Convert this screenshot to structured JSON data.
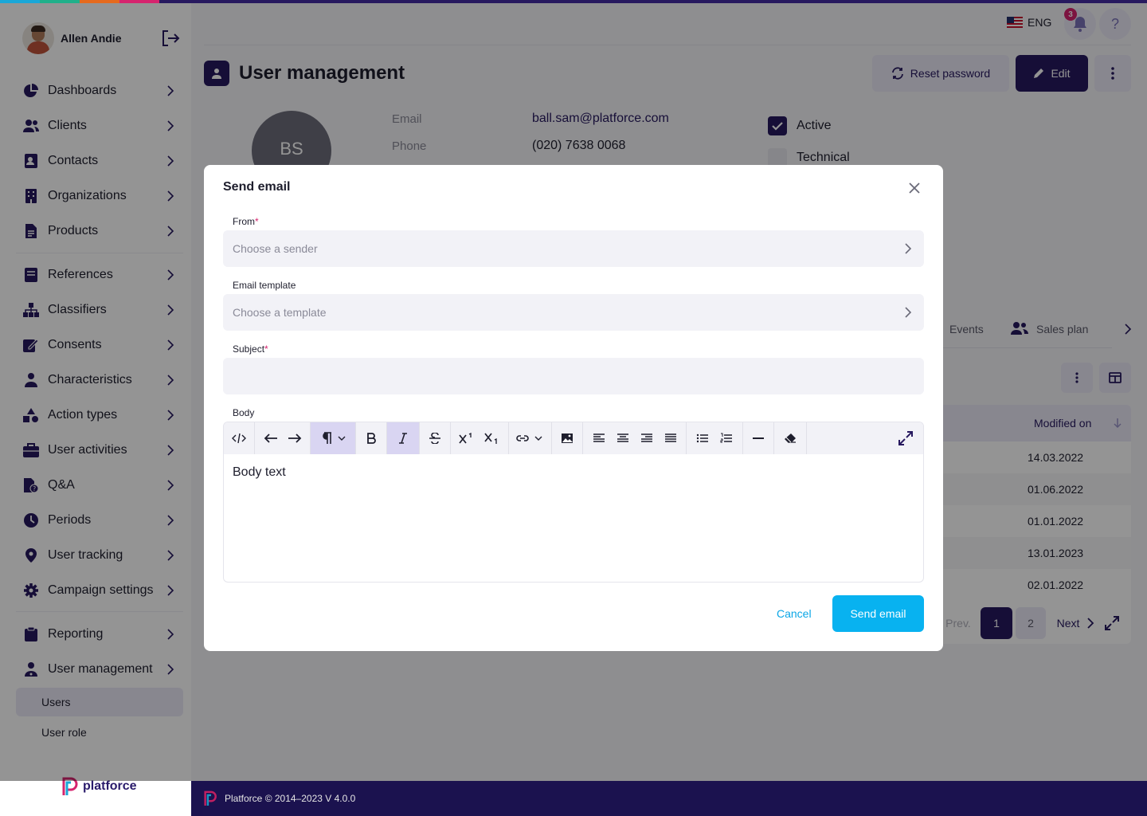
{
  "colors": {
    "primary": "#27195f",
    "accent_blue": "#08b2f0",
    "badge": "#d6246e",
    "stripe": [
      "#1aa7d8",
      "#20b08a",
      "#e56a1e",
      "#d6246e",
      "#27195f"
    ]
  },
  "user": {
    "name": "Allen Andie"
  },
  "sidebar": {
    "items": [
      {
        "label": "Dashboards",
        "icon": "pie-chart-icon"
      },
      {
        "label": "Clients",
        "icon": "users-icon"
      },
      {
        "label": "Contacts",
        "icon": "contact-book-icon"
      },
      {
        "label": "Organizations",
        "icon": "building-icon"
      },
      {
        "label": "Products",
        "icon": "document-icon"
      },
      {
        "label": "References",
        "icon": "book-icon"
      },
      {
        "label": "Classifiers",
        "icon": "hierarchy-icon"
      },
      {
        "label": "Consents",
        "icon": "signature-icon"
      },
      {
        "label": "Characteristics",
        "icon": "person-icon"
      },
      {
        "label": "Action types",
        "icon": "shapes-icon"
      },
      {
        "label": "User activities",
        "icon": "briefcase-icon"
      },
      {
        "label": "Q&A",
        "icon": "question-file-icon"
      },
      {
        "label": "Periods",
        "icon": "clock-icon"
      },
      {
        "label": "User tracking",
        "icon": "location-pin-icon"
      },
      {
        "label": "Campaign settings",
        "icon": "gear-icon"
      },
      {
        "label": "Reporting",
        "icon": "clipboard-icon"
      },
      {
        "label": "User management",
        "icon": "user-admin-icon"
      }
    ],
    "sub_items": [
      "Users",
      "User role"
    ],
    "active_sub": "Users"
  },
  "brand": {
    "name": "platforce"
  },
  "header": {
    "language": "ENG",
    "notifications_count": "3",
    "help": "?"
  },
  "page": {
    "title": "User management",
    "reset_password": "Reset password",
    "edit": "Edit",
    "avatar_initials": "BS",
    "email_label": "Email",
    "email_value": "ball.sam@platforce.com",
    "phone_label": "Phone",
    "phone_value": "(020) 7638 0068",
    "active_label": "Active",
    "active_checked": true,
    "technical_label": "Technical",
    "technical_checked": false
  },
  "tabs": [
    "Events",
    "Sales plan"
  ],
  "table": {
    "column": "Modified on",
    "rows": [
      "14.03.2022",
      "01.06.2022",
      "01.01.2022",
      "13.01.2023",
      "02.01.2022"
    ]
  },
  "pagination": {
    "prev": "Prev.",
    "pages": [
      "1",
      "2"
    ],
    "current": "1",
    "next": "Next"
  },
  "footer": {
    "text": "Platforce © 2014–2023 V 4.0.0"
  },
  "modal": {
    "title": "Send email",
    "from_label": "From",
    "from_placeholder": "Choose a sender",
    "template_label": "Email template",
    "template_placeholder": "Choose a template",
    "subject_label": "Subject",
    "subject_value": "",
    "body_label": "Body",
    "body_text": "Body text",
    "required_mark": "*",
    "cancel": "Cancel",
    "send": "Send email"
  }
}
